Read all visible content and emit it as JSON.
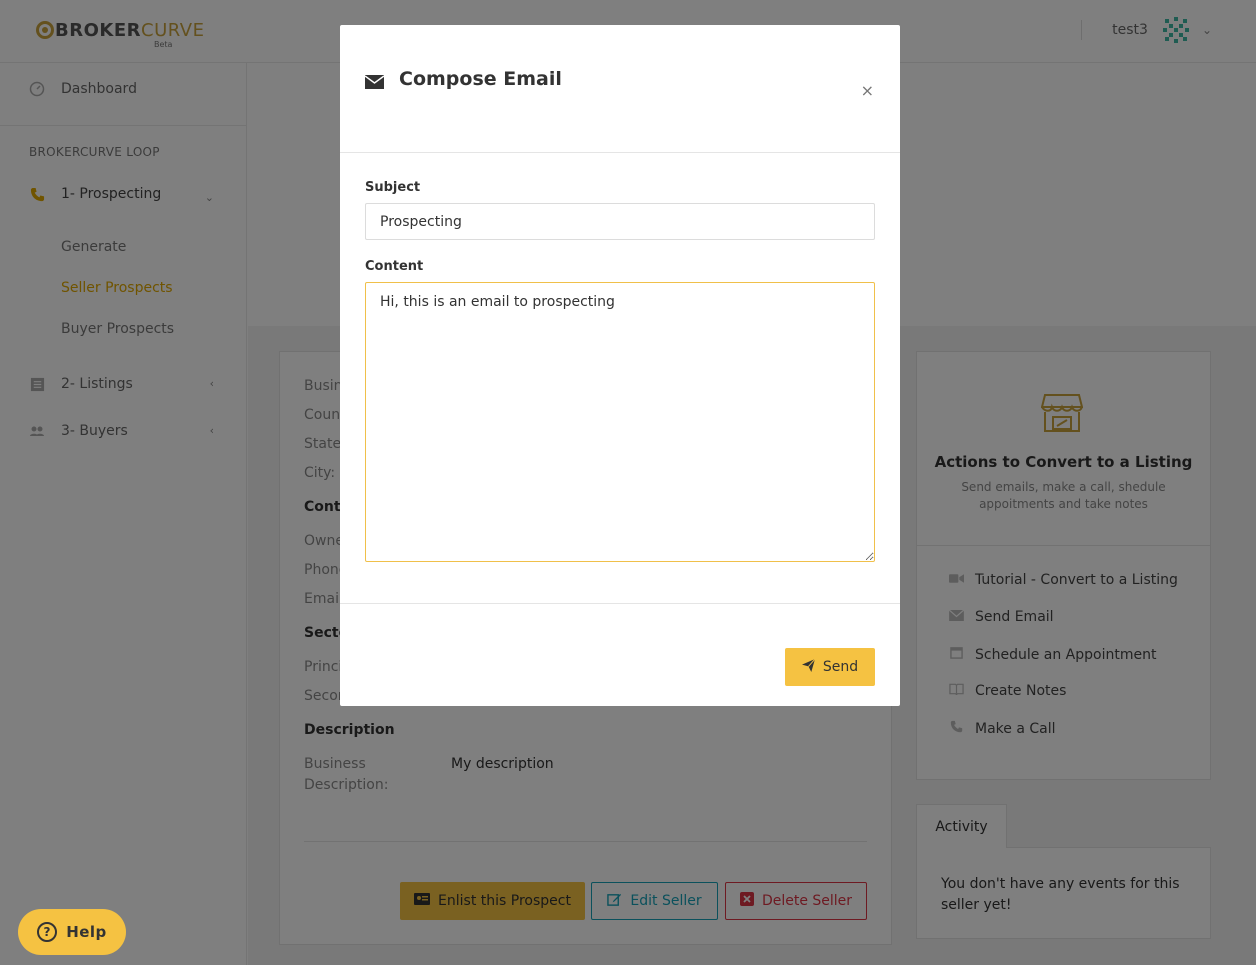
{
  "brand": {
    "name_part1": "BROKER",
    "name_part2": "CURVE",
    "badge": "Beta"
  },
  "header": {
    "username": "test3"
  },
  "sidebar": {
    "dashboard": "Dashboard",
    "section_header": "BROKERCURVE LOOP",
    "groups": [
      {
        "label": "1- Prospecting",
        "icon": "phone-icon",
        "expanded": true,
        "items": [
          "Generate",
          "Seller Prospects",
          "Buyer Prospects"
        ],
        "active_item": "Seller Prospects"
      },
      {
        "label": "2- Listings",
        "icon": "list-icon",
        "expanded": false
      },
      {
        "label": "3- Buyers",
        "icon": "users-icon",
        "expanded": false
      }
    ]
  },
  "seller": {
    "labels": [
      "Busin",
      "Count",
      "State",
      "City:"
    ],
    "contact_heading": "Conta",
    "contact_labels": [
      "Owne",
      "Phone",
      "Email"
    ],
    "sector_heading": "Secto",
    "sector_labels": [
      "Princi",
      "Secon"
    ],
    "description_heading": "Description",
    "business_description_label_1": "Business",
    "business_description_label_2": "Description:",
    "business_description_value": "My description",
    "buttons": {
      "enlist": "Enlist this Prospect",
      "edit": "Edit Seller",
      "delete": "Delete Seller"
    }
  },
  "actions": {
    "title": "Actions to Convert to a Listing",
    "subtitle": "Send emails, make a call, shedule appoitments and take notes",
    "items": [
      {
        "label": "Tutorial - Convert to a Listing",
        "icon": "video-icon"
      },
      {
        "label": "Send Email",
        "icon": "envelope-icon"
      },
      {
        "label": "Schedule an Appointment",
        "icon": "calendar-icon"
      },
      {
        "label": "Create Notes",
        "icon": "book-icon"
      },
      {
        "label": "Make a Call",
        "icon": "phone-icon"
      }
    ]
  },
  "activity": {
    "tab": "Activity",
    "empty_text": "You don't have any events for this seller yet!"
  },
  "modal": {
    "title": "Compose Email",
    "close": "×",
    "subject_label": "Subject",
    "subject_value": "Prospecting",
    "content_label": "Content",
    "content_value": "Hi, this is an email to prospecting",
    "send_label": "Send"
  },
  "help": {
    "label": "Help"
  },
  "colors": {
    "accent": "#f5c242",
    "active_link": "#e0a800",
    "edit": "#17a2b8",
    "delete": "#dc3545"
  }
}
